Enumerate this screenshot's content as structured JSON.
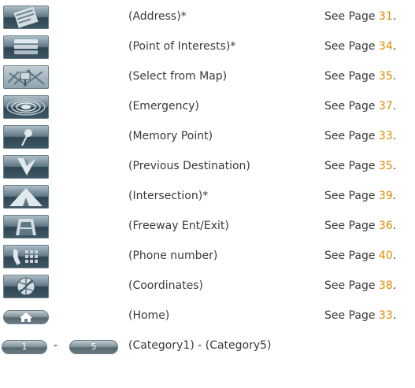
{
  "colors": {
    "page_link": "#e08a00",
    "text": "#3a3a3a",
    "icon_dark": "#2f4654"
  },
  "rows": [
    {
      "icon": "address-icon",
      "label": "(Address)*",
      "see_prefix": "See Page ",
      "page": "31",
      "suffix": "."
    },
    {
      "icon": "point-of-interests-icon",
      "label": "(Point of Interests)*",
      "see_prefix": "See Page ",
      "page": "34",
      "suffix": "."
    },
    {
      "icon": "select-from-map-icon",
      "label": "(Select from Map)",
      "see_prefix": "See Page ",
      "page": "35",
      "suffix": "."
    },
    {
      "icon": "emergency-icon",
      "label": "(Emergency)",
      "see_prefix": "See Page ",
      "page": "37",
      "suffix": "."
    },
    {
      "icon": "memory-point-icon",
      "label": "(Memory Point)",
      "see_prefix": "See Page ",
      "page": "33",
      "suffix": "."
    },
    {
      "icon": "previous-destination-icon",
      "label": "(Previous Destination)",
      "see_prefix": "See Page ",
      "page": "35",
      "suffix": "."
    },
    {
      "icon": "intersection-icon",
      "label": "(Intersection)*",
      "see_prefix": "See Page ",
      "page": "39",
      "suffix": "."
    },
    {
      "icon": "freeway-ent-exit-icon",
      "label": "(Freeway Ent/Exit)",
      "see_prefix": "See Page ",
      "page": "36",
      "suffix": "."
    },
    {
      "icon": "phone-number-icon",
      "label": "(Phone number)",
      "see_prefix": "See Page ",
      "page": "40",
      "suffix": "."
    },
    {
      "icon": "coordinates-icon",
      "label": "(Coordinates)",
      "see_prefix": "See Page ",
      "page": "38",
      "suffix": "."
    },
    {
      "icon": "home-icon",
      "label": "(Home)",
      "see_prefix": "See Page ",
      "page": "33",
      "suffix": "."
    }
  ],
  "category": {
    "first_button": "1",
    "separator": "-",
    "last_button": "5",
    "label": "(Category1) - (Category5)"
  }
}
